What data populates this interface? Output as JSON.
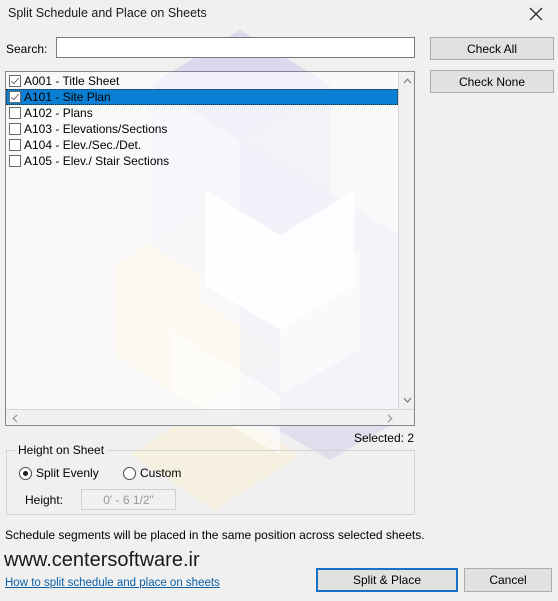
{
  "window": {
    "title": "Split Schedule and Place on Sheets",
    "close_icon": "close-icon"
  },
  "search": {
    "label": "Search:",
    "value": "",
    "placeholder": ""
  },
  "side_buttons": {
    "check_all": "Check All",
    "check_none": "Check None"
  },
  "sheet_list": {
    "items": [
      {
        "label": "A001 - Title Sheet",
        "checked": true,
        "selected": false
      },
      {
        "label": "A101 - Site Plan",
        "checked": true,
        "selected": true
      },
      {
        "label": "A102 - Plans",
        "checked": false,
        "selected": false
      },
      {
        "label": "A103 - Elevations/Sections",
        "checked": false,
        "selected": false
      },
      {
        "label": "A104 - Elev./Sec./Det.",
        "checked": false,
        "selected": false
      },
      {
        "label": "A105 - Elev./ Stair Sections",
        "checked": false,
        "selected": false
      }
    ],
    "scroll_up_icon": "chevron-up-icon",
    "scroll_down_icon": "chevron-down-icon",
    "scroll_left_icon": "chevron-left-icon",
    "scroll_right_icon": "chevron-right-icon"
  },
  "selected_count": "Selected: 2",
  "height_group": {
    "title": "Height on Sheet",
    "options": [
      {
        "label": "Split Evenly",
        "selected": true
      },
      {
        "label": "Custom",
        "selected": false
      }
    ],
    "height_label": "Height:",
    "height_value": "0' - 6 1/2\"",
    "height_enabled": false
  },
  "footer": {
    "note": "Schedule segments will be placed in the same position across selected sheets.",
    "brand": "www.centersoftware.ir",
    "help_link": "How to split schedule and place on sheets",
    "primary_button": "Split & Place",
    "cancel_button": "Cancel"
  },
  "colors": {
    "selection_blue": "#0b7fd4",
    "focus_blue": "#1572c4",
    "link_blue": "#0b5fa5",
    "dialog_bg": "#f0f0f0",
    "button_bg": "#e1e1e1",
    "watermark_purple": "#d9d5ec",
    "watermark_cream": "#fbf0d5"
  }
}
